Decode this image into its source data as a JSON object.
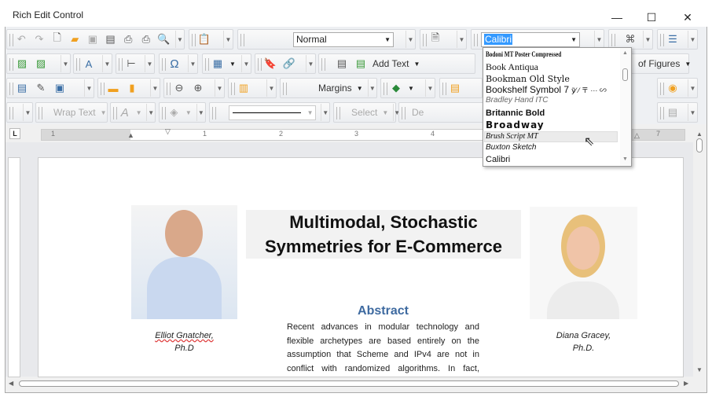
{
  "window": {
    "title": "Rich Edit Control",
    "minimize": "—",
    "maximize": "☐",
    "close": "✕"
  },
  "toolbar": {
    "style_value": "Normal",
    "font_value": "Calibri",
    "add_text": "Add Text",
    "table_of_figures": "of Figures",
    "margins": "Margins",
    "wrap_text": "Wrap Text",
    "select": "Select",
    "delete_partial": "De"
  },
  "font_list": {
    "items": [
      "Bodoni MT Poster Compressed",
      "Book Antiqua",
      "Bookman Old Style",
      "Bookshelf Symbol 7",
      "Bradley Hand ITC",
      "Britannic Bold",
      "Broadway",
      "Brush Script MT",
      "Buxton Sketch",
      "Calibri"
    ],
    "bookshelf_sample": "ỹ⁄ ⁄ 〒 ··· ∽",
    "hovered": "Brush Script MT"
  },
  "ruler": {
    "labels": [
      "1",
      "1",
      "2",
      "3",
      "4",
      "5",
      "6",
      "7"
    ]
  },
  "document": {
    "title_line1": "Multimodal, Stochastic",
    "title_line2": "Symmetries for E-Commerce",
    "abstract_heading": "Abstract",
    "abstract_lines": [
      "Recent advances in modular technology and",
      "flexible archetypes are based entirely on the",
      "assumption that Scheme and IPv4 are not in",
      "conflict with randomized algorithms. In fact,"
    ],
    "author1_name": "Elliot Gnatcher,",
    "author1_degree": "Ph.D",
    "author2_name": "Diana Gracey,",
    "author2_degree": "Ph.D."
  },
  "colors": {
    "accent": "#3a6ea5",
    "heading": "#3e6aa0",
    "selection": "#3399ff"
  }
}
